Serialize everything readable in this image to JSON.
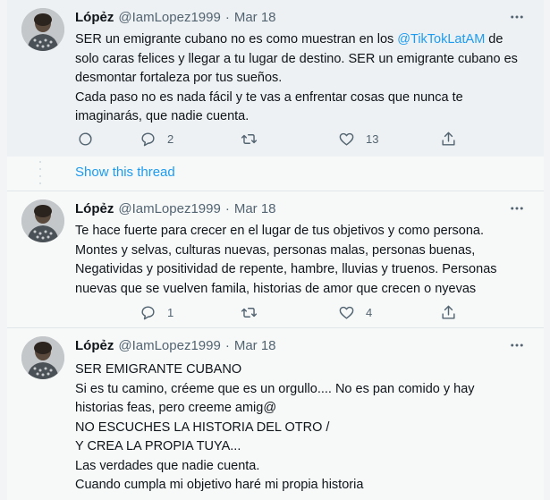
{
  "tweets": [
    {
      "name": "Lópẻz",
      "handle": "@IamLopez1999",
      "separator": "·",
      "date": "Mar 18",
      "lines": [
        {
          "pre": "SER un emigrante cubano no es como muestran en los ",
          "mention": "@TikTokLatAM",
          "post": "  de"
        },
        {
          "pre": "solo caras felices y llegar a tu lugar de destino. SER un emigrante cubano es",
          "mention": "",
          "post": ""
        },
        {
          "pre": "desmontar fortaleza por tus sueños.",
          "mention": "",
          "post": ""
        },
        {
          "pre": "Cada paso no es nada fácil y te vas a enfrentar cosas que nunca te",
          "mention": "",
          "post": ""
        },
        {
          "pre": "imaginarás, que nadie cuenta.",
          "mention": "",
          "post": ""
        }
      ],
      "replies": "2",
      "retweets": "",
      "likes": "13"
    },
    {
      "name": "Lópẻz",
      "handle": "@IamLopez1999",
      "separator": "·",
      "date": "Mar 18",
      "lines": [
        {
          "pre": "Te hace fuerte para crecer en el lugar de tus objetivos y como persona.",
          "mention": "",
          "post": ""
        },
        {
          "pre": "Montes y selvas, culturas nuevas, personas malas, personas buenas,",
          "mention": "",
          "post": ""
        },
        {
          "pre": "Negatividas y positividad de repente, hambre, lluvias y truenos. Personas",
          "mention": "",
          "post": ""
        },
        {
          "pre": "nuevas que se vuelven famila, historias de amor que crecen o nyevas",
          "mention": "",
          "post": ""
        }
      ],
      "replies": "1",
      "retweets": "",
      "likes": "4"
    },
    {
      "name": "Lópẻz",
      "handle": "@IamLopez1999",
      "separator": "·",
      "date": "Mar 18",
      "lines": [
        {
          "pre": "SER EMIGRANTE CUBANO",
          "mention": "",
          "post": ""
        },
        {
          "pre": "Si es tu camino, créeme que es un orgullo.... No es pan comido y hay",
          "mention": "",
          "post": ""
        },
        {
          "pre": "historias feas, pero creeme amig@",
          "mention": "",
          "post": ""
        },
        {
          "pre": "NO ESCUCHES LA HISTORIA DEL OTRO /",
          "mention": "",
          "post": ""
        },
        {
          "pre": "Y CREA LA PROPIA TUYA...",
          "mention": "",
          "post": ""
        },
        {
          "pre": "Las verdades que nadie cuenta.",
          "mention": "",
          "post": ""
        },
        {
          "pre": "Cuando cumpla mi objetivo haré mi propia historia",
          "mention": "",
          "post": ""
        }
      ],
      "replies": "",
      "retweets": "",
      "likes": ""
    }
  ],
  "show_thread_label": "Show this thread",
  "colors": {
    "accent": "#1d9bf0",
    "text": "#0f1419",
    "muted": "#536471"
  },
  "icons": [
    "analytics-icon",
    "reply-icon",
    "retweet-icon",
    "like-icon",
    "share-icon",
    "more-icon"
  ]
}
